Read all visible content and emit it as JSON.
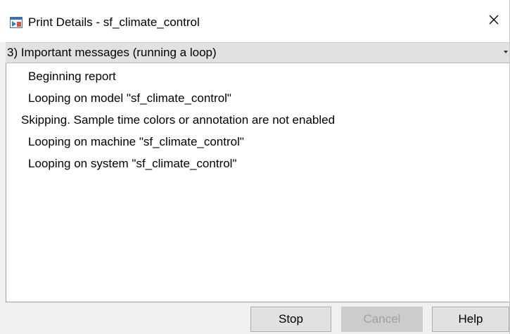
{
  "window": {
    "title": "Print Details - sf_climate_control",
    "close_icon": "close-icon",
    "app_icon": "print-window-icon"
  },
  "dropdown": {
    "selected": "3) Important messages (running a loop)"
  },
  "log": {
    "lines": [
      "Beginning report",
      "Looping on model \"sf_climate_control\"",
      "Skipping.  Sample time colors or annotation are not enabled",
      "Looping on machine \"sf_climate_control\"",
      "Looping on system \"sf_climate_control\""
    ]
  },
  "buttons": {
    "stop": "Stop",
    "cancel": "Cancel",
    "help": "Help"
  }
}
